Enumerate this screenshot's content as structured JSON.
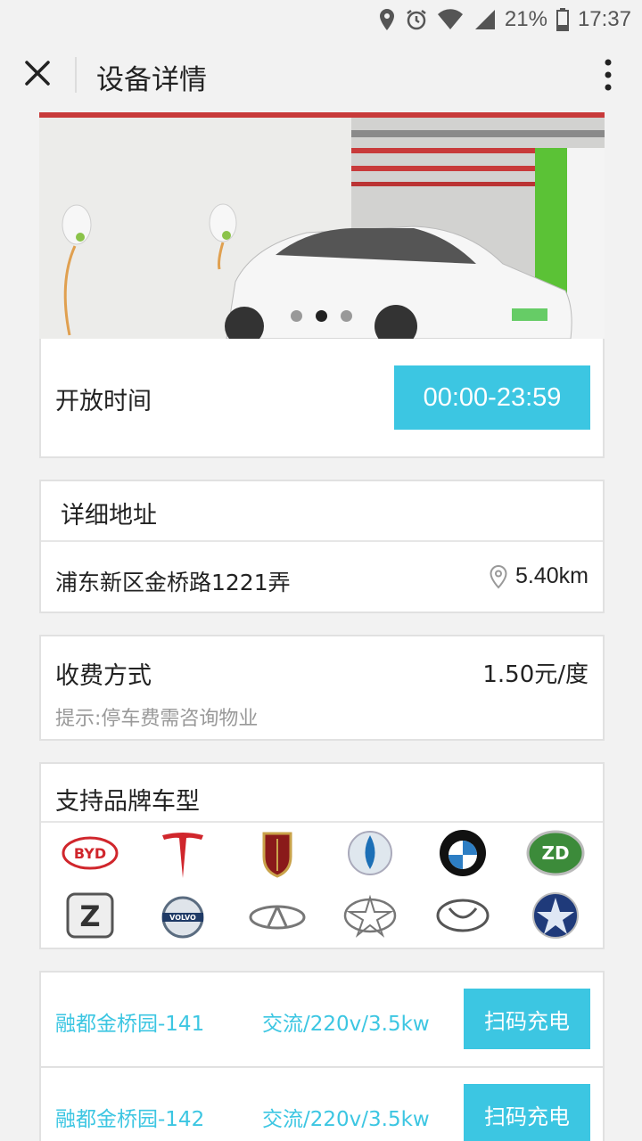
{
  "status_bar": {
    "battery": "21%",
    "time": "17:37"
  },
  "header": {
    "title": "设备详情"
  },
  "carousel": {
    "dot_count": 3,
    "active_index": 1
  },
  "open_hours": {
    "label": "开放时间",
    "value": "00:00-23:59"
  },
  "address": {
    "title": "详细地址",
    "text": "浦东新区金桥路1221弄",
    "distance": "5.40km"
  },
  "fee": {
    "title": "收费方式",
    "price": "1.50元/度",
    "hint": "提示:停车费需咨询物业"
  },
  "brands": {
    "title": "支持品牌车型",
    "logos": [
      "byd-logo",
      "tesla-logo",
      "roewe-logo",
      "venucia-logo",
      "bmw-logo",
      "zd-logo",
      "zotye-logo",
      "volvo-logo",
      "chery-logo",
      "jac-logo",
      "dongfeng-logo",
      "star-logo"
    ]
  },
  "stations": [
    {
      "name": "融都金桥园-141",
      "spec": "交流/220v/3.5kw",
      "button": "扫码充电"
    },
    {
      "name": "融都金桥园-142",
      "spec": "交流/220v/3.5kw",
      "button": "扫码充电"
    }
  ],
  "colors": {
    "accent": "#3cc6e2",
    "background": "#f2f2f2"
  }
}
